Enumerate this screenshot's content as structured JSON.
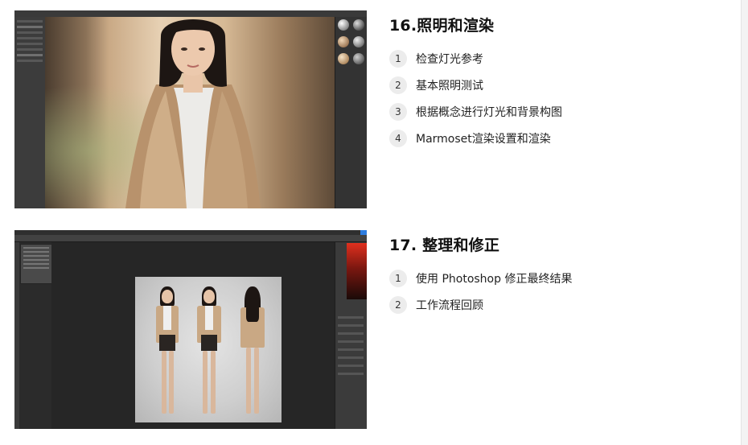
{
  "sections": [
    {
      "title": "16.照明和渲染",
      "steps": [
        {
          "num": "1",
          "label": "检查灯光参考"
        },
        {
          "num": "2",
          "label": "基本照明测试"
        },
        {
          "num": "3",
          "label": "根据概念进行灯光和背景构图"
        },
        {
          "num": "4",
          "label": "Marmoset渲染设置和渲染"
        }
      ]
    },
    {
      "title": "17. 整理和修正",
      "steps": [
        {
          "num": "1",
          "label": "使用 Photoshop 修正最终结果"
        },
        {
          "num": "2",
          "label": "工作流程回顾"
        }
      ]
    }
  ],
  "colors": {
    "step_badge_bg": "#ececec",
    "title": "#111111",
    "text": "#222222"
  }
}
